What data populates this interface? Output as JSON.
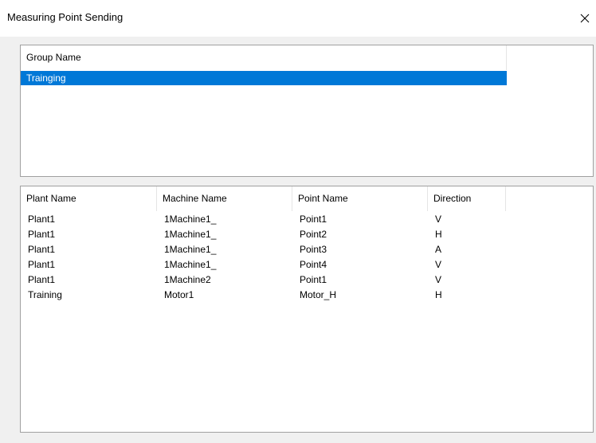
{
  "window": {
    "title": "Measuring Point Sending",
    "close_glyph": "close-icon"
  },
  "group_list": {
    "columns": [
      "Group Name"
    ],
    "rows": [
      "Trainging"
    ],
    "selected_index": 0
  },
  "points_list": {
    "columns": [
      "Plant Name",
      "Machine Name",
      "Point Name",
      "Direction"
    ],
    "rows": [
      [
        "Plant1",
        "1Machine1_",
        "Point1",
        "V"
      ],
      [
        "Plant1",
        "1Machine1_",
        "Point2",
        "H"
      ],
      [
        "Plant1",
        "1Machine1_",
        "Point3",
        "A"
      ],
      [
        "Plant1",
        "1Machine1_",
        "Point4",
        "V"
      ],
      [
        "Plant1",
        "1Machine2",
        "Point1",
        "V"
      ],
      [
        "Training",
        "Motor1",
        "Motor_H",
        "H"
      ]
    ]
  },
  "colors": {
    "selection": "#0078d7",
    "dialog_background": "#f0f0f0",
    "list_border": "#a0a0a0"
  }
}
